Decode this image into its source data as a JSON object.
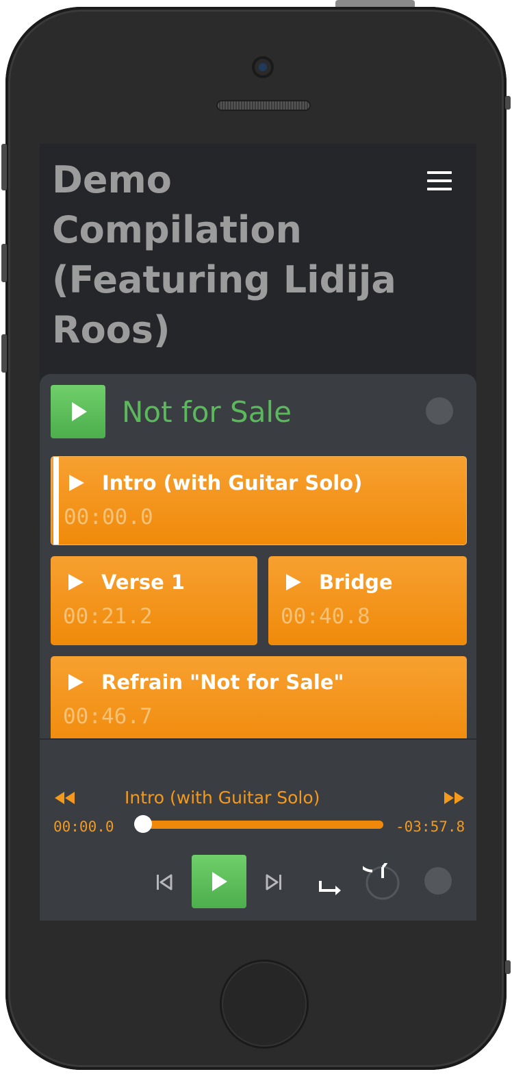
{
  "header": {
    "title": "Demo Compilation (Featuring Lidija Roos)",
    "menu_icon": "hamburger-icon"
  },
  "album": {
    "name": "Not for Sale",
    "play_icon": "play-icon",
    "status_icon": "status-dot-icon"
  },
  "cues": [
    {
      "name": "Intro (with Guitar Solo)",
      "time": "00:00.0"
    },
    {
      "name": "Verse 1",
      "time": "00:21.2"
    },
    {
      "name": "Bridge",
      "time": "00:40.8"
    },
    {
      "name": "Refrain \"Not for Sale\"",
      "time": "00:46.7"
    }
  ],
  "player": {
    "now_playing": "Intro (with Guitar Solo)",
    "elapsed": "00:00.0",
    "remaining": "-03:57.8",
    "progress": 0,
    "icons": {
      "rewind": "rewind-icon",
      "fast_forward": "fast-forward-icon",
      "previous": "skip-previous-icon",
      "play": "play-icon",
      "next": "skip-next-icon",
      "autoplay": "autoplay-arrow-icon",
      "fade": "fade-timer-icon",
      "status": "status-dot-icon"
    }
  },
  "colors": {
    "accent_orange": "#f08a0a",
    "play_green": "#5cb85c",
    "background": "#24262a",
    "panel": "#3a3e42",
    "title_gray": "#9c9c9c"
  }
}
